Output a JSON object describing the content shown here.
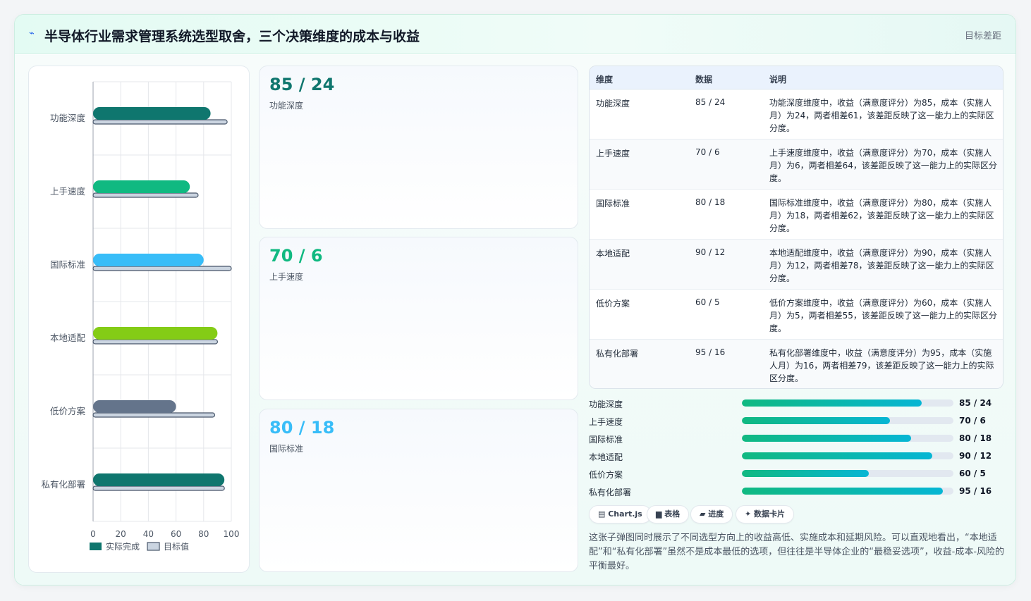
{
  "header": {
    "icon": "line-chart-icon",
    "title": "半导体行业需求管理系统选型取舍，三个决策维度的成本与收益",
    "right_label": "目标差距"
  },
  "colors": {
    "accent": "#0f766e",
    "series": [
      "#0f766e",
      "#10b981",
      "#38bdf8",
      "#84cc16",
      "#64748b",
      "#0f766e"
    ],
    "target": "#cbd5e1"
  },
  "chart_data": {
    "type": "bar",
    "orientation": "horizontal",
    "categories": [
      "功能深度",
      "上手速度",
      "国际标准",
      "本地适配",
      "低价方案",
      "私有化部署"
    ],
    "series": [
      {
        "name": "实际完成",
        "values": [
          85,
          70,
          80,
          90,
          60,
          95
        ]
      },
      {
        "name": "目标值",
        "values": [
          97,
          76,
          100,
          90,
          88,
          95
        ]
      }
    ],
    "xlim": [
      0,
      100
    ],
    "xticks": [
      "0",
      "20",
      "40",
      "60",
      "80",
      "100"
    ],
    "grid": true,
    "legend": "bottom"
  },
  "stat_cards": [
    {
      "value": "85 / 24",
      "label": "功能深度",
      "color": "#0f766e"
    },
    {
      "value": "70 / 6",
      "label": "上手速度",
      "color": "#10b981"
    },
    {
      "value": "80 / 18",
      "label": "国际标准",
      "color": "#38bdf8"
    }
  ],
  "table": {
    "headers": [
      "维度",
      "数据",
      "说明"
    ],
    "rows": [
      {
        "dim": "功能深度",
        "data": "85 / 24",
        "desc": "功能深度维度中，收益（满意度评分）为85，成本（实施人月）为24，两者相差61，该差距反映了这一能力上的实际区分度。"
      },
      {
        "dim": "上手速度",
        "data": "70 / 6",
        "desc": "上手速度维度中，收益（满意度评分）为70，成本（实施人月）为6，两者相差64，该差距反映了这一能力上的实际区分度。"
      },
      {
        "dim": "国际标准",
        "data": "80 / 18",
        "desc": "国际标准维度中，收益（满意度评分）为80，成本（实施人月）为18，两者相差62，该差距反映了这一能力上的实际区分度。"
      },
      {
        "dim": "本地适配",
        "data": "90 / 12",
        "desc": "本地适配维度中，收益（满意度评分）为90，成本（实施人月）为12，两者相差78，该差距反映了这一能力上的实际区分度。"
      },
      {
        "dim": "低价方案",
        "data": "60 / 5",
        "desc": "低价方案维度中，收益（满意度评分）为60，成本（实施人月）为5，两者相差55，该差距反映了这一能力上的实际区分度。"
      },
      {
        "dim": "私有化部署",
        "data": "95 / 16",
        "desc": "私有化部署维度中，收益（满意度评分）为95，成本（实施人月）为16，两者相差79，该差距反映了这一能力上的实际区分度。"
      }
    ]
  },
  "progress": [
    {
      "label": "功能深度",
      "value": "85 / 24",
      "fraction": 0.85
    },
    {
      "label": "上手速度",
      "value": "70 / 6",
      "fraction": 0.7
    },
    {
      "label": "国际标准",
      "value": "80 / 18",
      "fraction": 0.8
    },
    {
      "label": "本地适配",
      "value": "90 / 12",
      "fraction": 0.9
    },
    {
      "label": "低价方案",
      "value": "60 / 5",
      "fraction": 0.6
    },
    {
      "label": "私有化部署",
      "value": "95 / 16",
      "fraction": 0.95
    }
  ],
  "tags": [
    {
      "icon": "chart-icon",
      "label": "▤ Chart.js"
    },
    {
      "icon": "table-icon",
      "label": "▆ 表格"
    },
    {
      "icon": "progress-icon",
      "label": "▰ 进度"
    },
    {
      "icon": "sparkle-icon",
      "label": "✦ 数据卡片"
    }
  ],
  "description": "这张子弹图同时展示了不同选型方向上的收益高低、实施成本和延期风险。可以直观地看出，“本地适配”和“私有化部署”虽然不是成本最低的选项，但往往是半导体企业的“最稳妥选项”，收益-成本-风险的平衡最好。"
}
